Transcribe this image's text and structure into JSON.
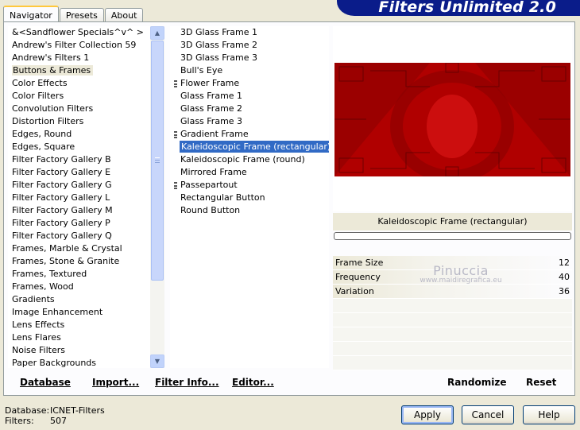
{
  "tabs": [
    "Navigator",
    "Presets",
    "About"
  ],
  "app_title": "Filters Unlimited 2.0",
  "categories": [
    "&<Sandflower Specials^v^ >",
    "Andrew's Filter Collection 59",
    "Andrew's Filters 1",
    "Buttons & Frames",
    "Color Effects",
    "Color Filters",
    "Convolution Filters",
    "Distortion Filters",
    "Edges, Round",
    "Edges, Square",
    "Filter Factory Gallery B",
    "Filter Factory Gallery E",
    "Filter Factory Gallery G",
    "Filter Factory Gallery L",
    "Filter Factory Gallery M",
    "Filter Factory Gallery P",
    "Filter Factory Gallery Q",
    "Frames, Marble & Crystal",
    "Frames, Stone & Granite",
    "Frames, Textured",
    "Frames, Wood",
    "Gradients",
    "Image Enhancement",
    "Lens Effects",
    "Lens Flares",
    "Noise Filters",
    "Paper Backgrounds"
  ],
  "selected_category": "Buttons & Frames",
  "filters": [
    {
      "label": "3D Glass Frame 1",
      "group": false
    },
    {
      "label": "3D Glass Frame 2",
      "group": false
    },
    {
      "label": "3D Glass Frame 3",
      "group": false
    },
    {
      "label": "Bull's Eye",
      "group": false
    },
    {
      "label": "Flower Frame",
      "group": true
    },
    {
      "label": "Glass Frame 1",
      "group": false
    },
    {
      "label": "Glass Frame 2",
      "group": false
    },
    {
      "label": "Glass Frame 3",
      "group": false
    },
    {
      "label": "Gradient Frame",
      "group": true
    },
    {
      "label": "Kaleidoscopic Frame (rectangular)",
      "group": false
    },
    {
      "label": "Kaleidoscopic Frame (round)",
      "group": false
    },
    {
      "label": "Mirrored Frame",
      "group": false
    },
    {
      "label": "Passepartout",
      "group": true
    },
    {
      "label": "Rectangular Button",
      "group": false
    },
    {
      "label": "Round Button",
      "group": false
    }
  ],
  "selected_filter": "Kaleidoscopic Frame (rectangular)",
  "preview": {
    "filter_name": "Kaleidoscopic Frame (rectangular)",
    "progress": 0,
    "colors": {
      "base": "#b00000",
      "dark": "#8a0000",
      "light": "#e01818"
    }
  },
  "parameters": [
    {
      "label": "Frame Size",
      "value": "12"
    },
    {
      "label": "Frequency",
      "value": "40"
    },
    {
      "label": "Variation",
      "value": "36"
    }
  ],
  "watermark": {
    "name": "Pinuccia",
    "url": "www.maidiregrafica.eu"
  },
  "bottom_links": {
    "database": "Database",
    "import": "Import...",
    "filter_info": "Filter Info...",
    "editor": "Editor...",
    "randomize": "Randomize",
    "reset": "Reset"
  },
  "status": {
    "database_label": "Database:",
    "database_value": "ICNET-Filters",
    "filters_label": "Filters:",
    "filters_value": "507"
  },
  "buttons": {
    "apply": "Apply",
    "cancel": "Cancel",
    "help": "Help"
  },
  "icons": {
    "scroll_up": "arrow-up-icon",
    "scroll_down": "arrow-down-icon",
    "group_marker": "group-marker-icon"
  },
  "accent_colors": {
    "title_banner": "#0a1c8a",
    "selection": "#316ac5",
    "tab_highlight": "#ffc83c"
  }
}
